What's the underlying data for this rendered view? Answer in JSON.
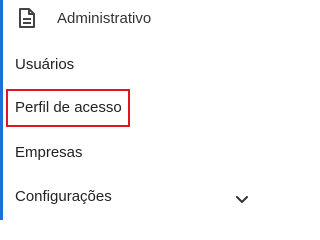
{
  "header": {
    "icon": "document-icon",
    "label": "Administrativo"
  },
  "items": [
    {
      "label": "Usuários"
    },
    {
      "label": "Perfil de acesso",
      "highlighted": true
    },
    {
      "label": "Empresas"
    },
    {
      "label": "Configurações",
      "icon": "chevron-down-icon"
    }
  ],
  "colors": {
    "accent": "#1e6fd9",
    "highlight": "#e0161e",
    "text": "#222222"
  }
}
